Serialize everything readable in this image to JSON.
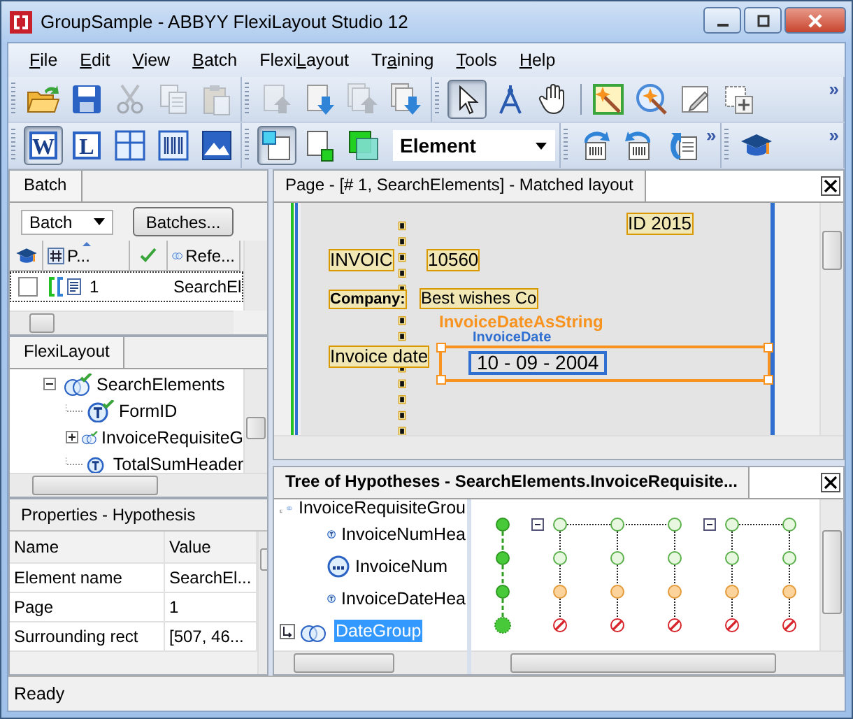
{
  "window": {
    "title": "GroupSample - ABBYY FlexiLayout Studio 12"
  },
  "menu": [
    {
      "key": "F",
      "post": "ile"
    },
    {
      "key": "E",
      "post": "dit"
    },
    {
      "key": "V",
      "post": "iew"
    },
    {
      "key": "B",
      "post": "atch"
    },
    {
      "pre": "Flexi",
      "key": "L",
      "post": "ayout"
    },
    {
      "pre": "Tr",
      "key": "a",
      "post": "ining"
    },
    {
      "key": "T",
      "post": "ools"
    },
    {
      "key": "H",
      "post": "elp"
    }
  ],
  "toolbar_rows": [
    {
      "groups": [
        {
          "buttons": [
            {
              "kind": "open",
              "pressed": false,
              "disabled": false
            },
            {
              "kind": "save",
              "pressed": false,
              "disabled": false
            },
            {
              "kind": "cut",
              "pressed": false,
              "disabled": true
            },
            {
              "kind": "copy",
              "pressed": false,
              "disabled": true
            },
            {
              "kind": "paste",
              "pressed": false,
              "disabled": true
            }
          ]
        },
        {
          "buttons": [
            {
              "kind": "page-up",
              "pressed": false,
              "disabled": true
            },
            {
              "kind": "page-down",
              "pressed": false,
              "disabled": false
            },
            {
              "kind": "pages-up",
              "pressed": false,
              "disabled": true
            },
            {
              "kind": "pages-down",
              "pressed": false,
              "disabled": false
            }
          ]
        },
        {
          "buttons": [
            {
              "kind": "pointer",
              "pressed": true,
              "disabled": false
            },
            {
              "kind": "compass",
              "pressed": false,
              "disabled": false
            },
            {
              "kind": "hand",
              "pressed": false,
              "disabled": false
            },
            {
              "kind": "separator"
            },
            {
              "kind": "wand",
              "pressed": false,
              "disabled": false
            },
            {
              "kind": "wand-search",
              "pressed": false,
              "disabled": false
            },
            {
              "kind": "pencil-page",
              "pressed": false,
              "disabled": false
            },
            {
              "kind": "add-page",
              "pressed": false,
              "disabled": false
            }
          ],
          "overflow": "»"
        }
      ]
    },
    {
      "groups": [
        {
          "buttons": [
            {
              "kind": "letter",
              "label": "W",
              "pressed": true,
              "disabled": false
            },
            {
              "kind": "letter",
              "label": "L",
              "pressed": false,
              "disabled": false
            },
            {
              "kind": "grid",
              "pressed": false,
              "disabled": false
            },
            {
              "kind": "barcode",
              "pressed": false,
              "disabled": false
            },
            {
              "kind": "image",
              "pressed": false,
              "disabled": false
            }
          ]
        },
        {
          "buttons": [
            {
              "kind": "select-block",
              "pressed": true,
              "disabled": false
            },
            {
              "kind": "block-corner",
              "pressed": false,
              "disabled": false
            },
            {
              "kind": "green-square",
              "pressed": false,
              "disabled": false
            },
            {
              "kind": "dropdown",
              "value": "Element"
            }
          ]
        },
        {
          "buttons": [
            {
              "kind": "rotate-right",
              "pressed": false,
              "disabled": false
            },
            {
              "kind": "rotate-left",
              "pressed": false,
              "disabled": false
            },
            {
              "kind": "page-back",
              "pressed": false,
              "disabled": false
            }
          ],
          "overflow": "»"
        },
        {
          "buttons": [
            {
              "kind": "cap",
              "pressed": false,
              "disabled": false
            }
          ],
          "overflow": "»"
        }
      ]
    }
  ],
  "batch_panel": {
    "tab": "Batch",
    "batch_select": "Batch",
    "batches_button": "Batches...",
    "columns": [
      {
        "kind": "cap"
      },
      {
        "kind": "page",
        "label": "P...",
        "sorted": true
      },
      {
        "kind": "check"
      },
      {
        "kind": "reference",
        "label": "Refe..."
      }
    ],
    "rows": [
      {
        "checked": false,
        "page": "1",
        "reference": "SearchEl"
      }
    ]
  },
  "flexilayout_panel": {
    "tab": "FlexiLayout",
    "tree": [
      {
        "label": "SearchElements",
        "kind": "group",
        "verified": true,
        "expanded": true,
        "children": [
          {
            "label": "FormID",
            "kind": "text",
            "verified": true
          },
          {
            "label": "InvoiceRequisiteG",
            "kind": "group",
            "verified": true,
            "expanded": false
          },
          {
            "label": "TotalSumHeader",
            "kind": "text",
            "verified": false
          }
        ]
      }
    ]
  },
  "properties_panel": {
    "title": "Properties - Hypothesis",
    "columns": [
      "Name",
      "Value"
    ],
    "rows": [
      {
        "name": "Element name",
        "value": "SearchEl..."
      },
      {
        "name": "Page",
        "value": "1"
      },
      {
        "name": "Surrounding rect",
        "value": "[507, 46..."
      }
    ]
  },
  "page_panel": {
    "title": "Page - [# 1, SearchElements] - Matched layout",
    "document": [
      {
        "text": "ID 2015",
        "kind": "large"
      },
      {
        "text": "INVOIC",
        "kind": "large"
      },
      {
        "text": "10560",
        "kind": "large"
      },
      {
        "text": "Company:",
        "kind": "bold"
      },
      {
        "text": "Best wishes Co",
        "kind": "normal"
      },
      {
        "text": "Invoice date",
        "kind": "large"
      }
    ],
    "regions": [
      {
        "label": "InvoiceDateAsString",
        "color": "#f7931e"
      },
      {
        "label": "InvoiceDate",
        "value": "10 - 09 - 2004",
        "color": "#2f6fd0"
      }
    ]
  },
  "hypotheses_panel": {
    "title": "Tree of Hypotheses - SearchElements.InvoiceRequisite...",
    "items": [
      {
        "label": "InvoiceRequisiteGrou",
        "kind": "parent-group",
        "selected": false
      },
      {
        "label": "InvoiceNumHea",
        "kind": "text",
        "selected": false
      },
      {
        "label": "InvoiceNum",
        "kind": "string",
        "selected": false
      },
      {
        "label": "InvoiceDateHea",
        "kind": "text",
        "selected": false
      },
      {
        "label": "DateGroup",
        "kind": "child-group",
        "selected": true
      }
    ],
    "columns": [
      {
        "nodes": [
          {
            "kind": "match"
          },
          {
            "kind": "match"
          },
          {
            "kind": "match"
          },
          {
            "kind": "best"
          }
        ]
      },
      {
        "expanded": true,
        "nodes": [
          {
            "kind": "candidate"
          },
          {
            "kind": "candidate"
          },
          {
            "kind": "partial"
          },
          {
            "kind": "rejected"
          }
        ]
      },
      {
        "nodes": [
          {
            "kind": "candidate"
          },
          {
            "kind": "candidate"
          },
          {
            "kind": "partial"
          },
          {
            "kind": "rejected"
          }
        ]
      },
      {
        "nodes": [
          {
            "kind": "candidate"
          },
          {
            "kind": "candidate"
          },
          {
            "kind": "partial"
          },
          {
            "kind": "rejected"
          }
        ]
      },
      {
        "expanded": true,
        "nodes": [
          {
            "kind": "candidate"
          },
          {
            "kind": "candidate"
          },
          {
            "kind": "partial"
          },
          {
            "kind": "rejected"
          }
        ]
      },
      {
        "nodes": [
          {
            "kind": "candidate"
          },
          {
            "kind": "candidate"
          },
          {
            "kind": "partial"
          },
          {
            "kind": "rejected"
          }
        ]
      }
    ]
  },
  "status_bar": "Ready"
}
